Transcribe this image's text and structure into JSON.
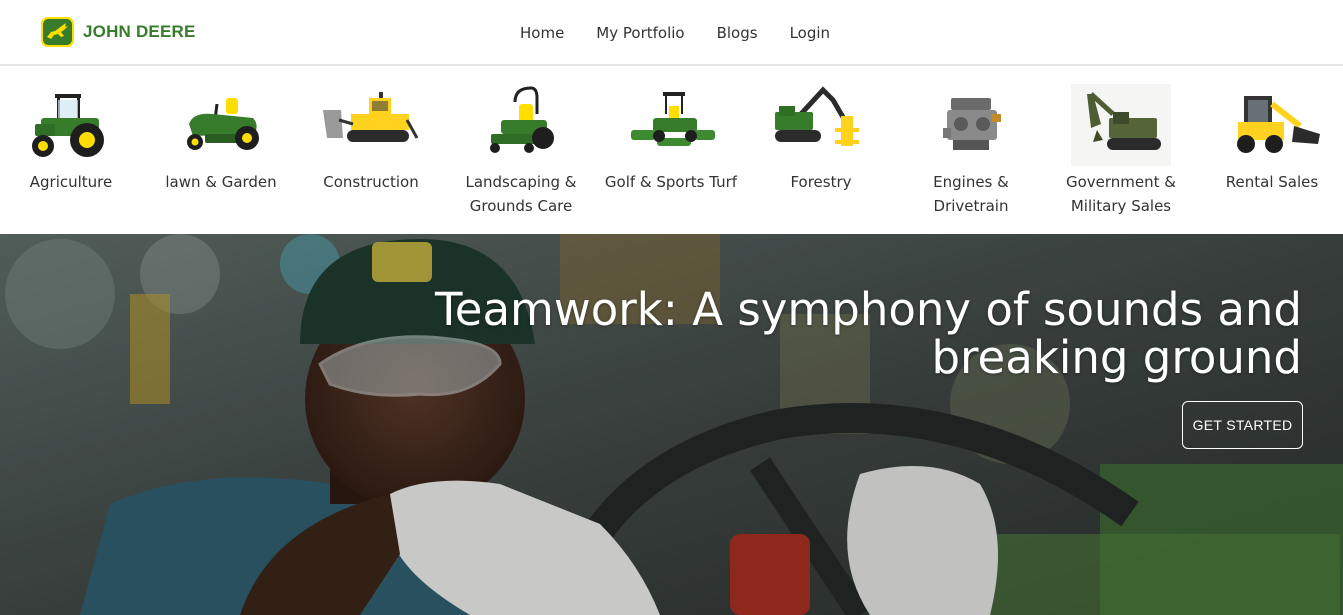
{
  "brand": {
    "name": "JOHN DEERE",
    "logo_icon": "leaping-deer-logo",
    "colors": {
      "green": "#367c2b",
      "yellow": "#ffde00"
    }
  },
  "nav": {
    "items": [
      "Home",
      "My Portfolio",
      "Blogs",
      "Login"
    ]
  },
  "categories": [
    {
      "label": "Agriculture",
      "icon": "tractor-icon"
    },
    {
      "label": "lawn & Garden",
      "icon": "lawn-mower-icon"
    },
    {
      "label": "Construction",
      "icon": "bulldozer-icon"
    },
    {
      "label": "Landscaping &\nGrounds Care",
      "icon": "zero-turn-mower-icon"
    },
    {
      "label": "Golf & Sports Turf",
      "icon": "turf-mower-icon"
    },
    {
      "label": "Forestry",
      "icon": "forestry-machine-icon"
    },
    {
      "label": "Engines &\nDrivetrain",
      "icon": "engine-icon"
    },
    {
      "label": "Government &\nMilitary Sales",
      "icon": "excavator-icon"
    },
    {
      "label": "Rental Sales",
      "icon": "skid-steer-icon"
    }
  ],
  "hero": {
    "title": "Teamwork: A symphony of sounds and breaking ground",
    "cta": "GET STARTED",
    "image": "worker-in-cap-and-safety-glasses-at-steering-wheel"
  }
}
